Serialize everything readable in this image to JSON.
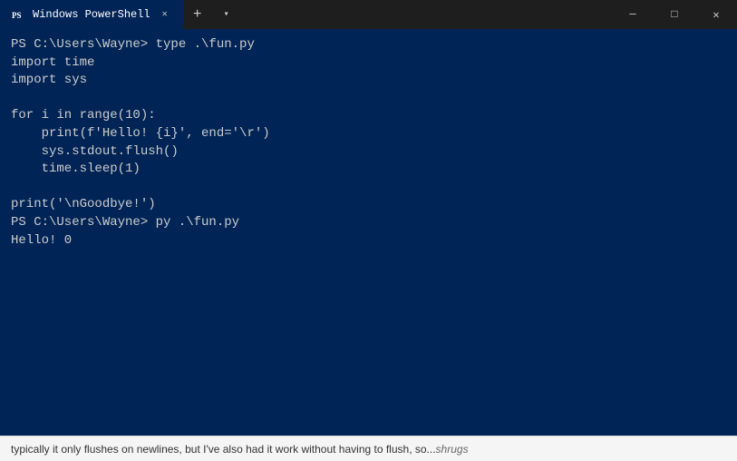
{
  "titlebar": {
    "tab_label": "Windows PowerShell",
    "new_tab_icon": "+",
    "dropdown_icon": "▾",
    "minimize_icon": "─",
    "maximize_icon": "□",
    "close_icon": "✕"
  },
  "terminal": {
    "lines": [
      "PS C:\\Users\\Wayne> type .\\fun.py",
      "import time",
      "import sys",
      "",
      "for i in range(10):",
      "    print(f'Hello! {i}', end='\\r')",
      "    sys.stdout.flush()",
      "    time.sleep(1)",
      "",
      "print('\\nGoodbye!')",
      "PS C:\\Users\\Wayne> py .\\fun.py",
      "Hello! 0"
    ]
  },
  "bottom_bar": {
    "normal_text": "typically it only flushes on newlines, but I've also had it work without having to flush, so...",
    "italic_text": " shrugs"
  }
}
